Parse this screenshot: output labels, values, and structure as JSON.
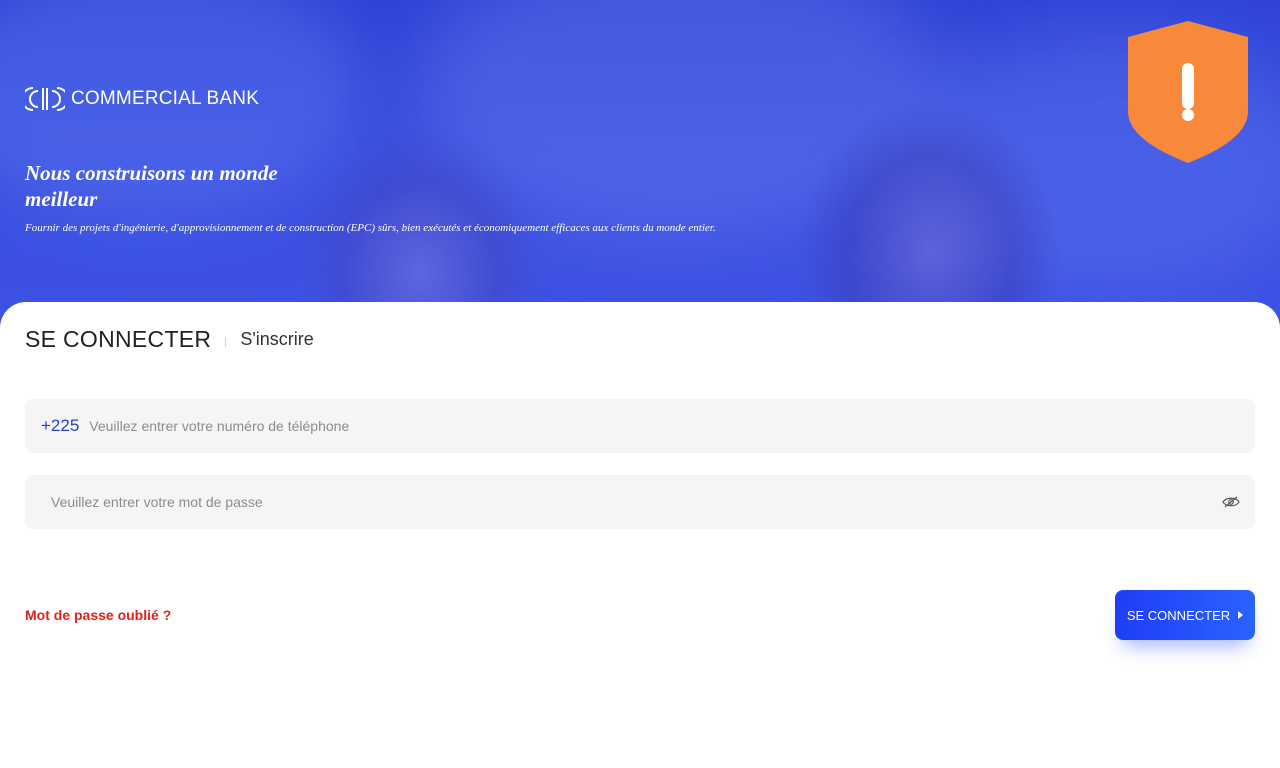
{
  "brand": {
    "name": "COMMERCIAL BANK",
    "headline": "Nous construisons un monde meilleur",
    "subline": "Fournir des projets d'ingénierie, d'approvisionnement et de construction (EPC) sûrs, bien exécutés et économiquement efficaces aux clients du monde entier."
  },
  "tabs": {
    "login": "SE CONNECTER",
    "register": "S'inscrire"
  },
  "form": {
    "phone_prefix": "+225",
    "phone_placeholder": "Veuillez entrer votre numéro de téléphone",
    "password_placeholder": "Veuillez entrer votre mot de passe",
    "forgot_label": "Mot de passe oublié ?",
    "submit_label": "SE CONNECTER"
  },
  "icons": {
    "logo": "bank-logo-icon",
    "alert": "shield-alert-icon",
    "password_toggle": "eye-icon",
    "submit": "caret-right-icon"
  },
  "colors": {
    "hero": "#3a4fe0",
    "accent": "#2b3fc9",
    "shield": "#f9893a",
    "forgot": "#e0221b"
  }
}
